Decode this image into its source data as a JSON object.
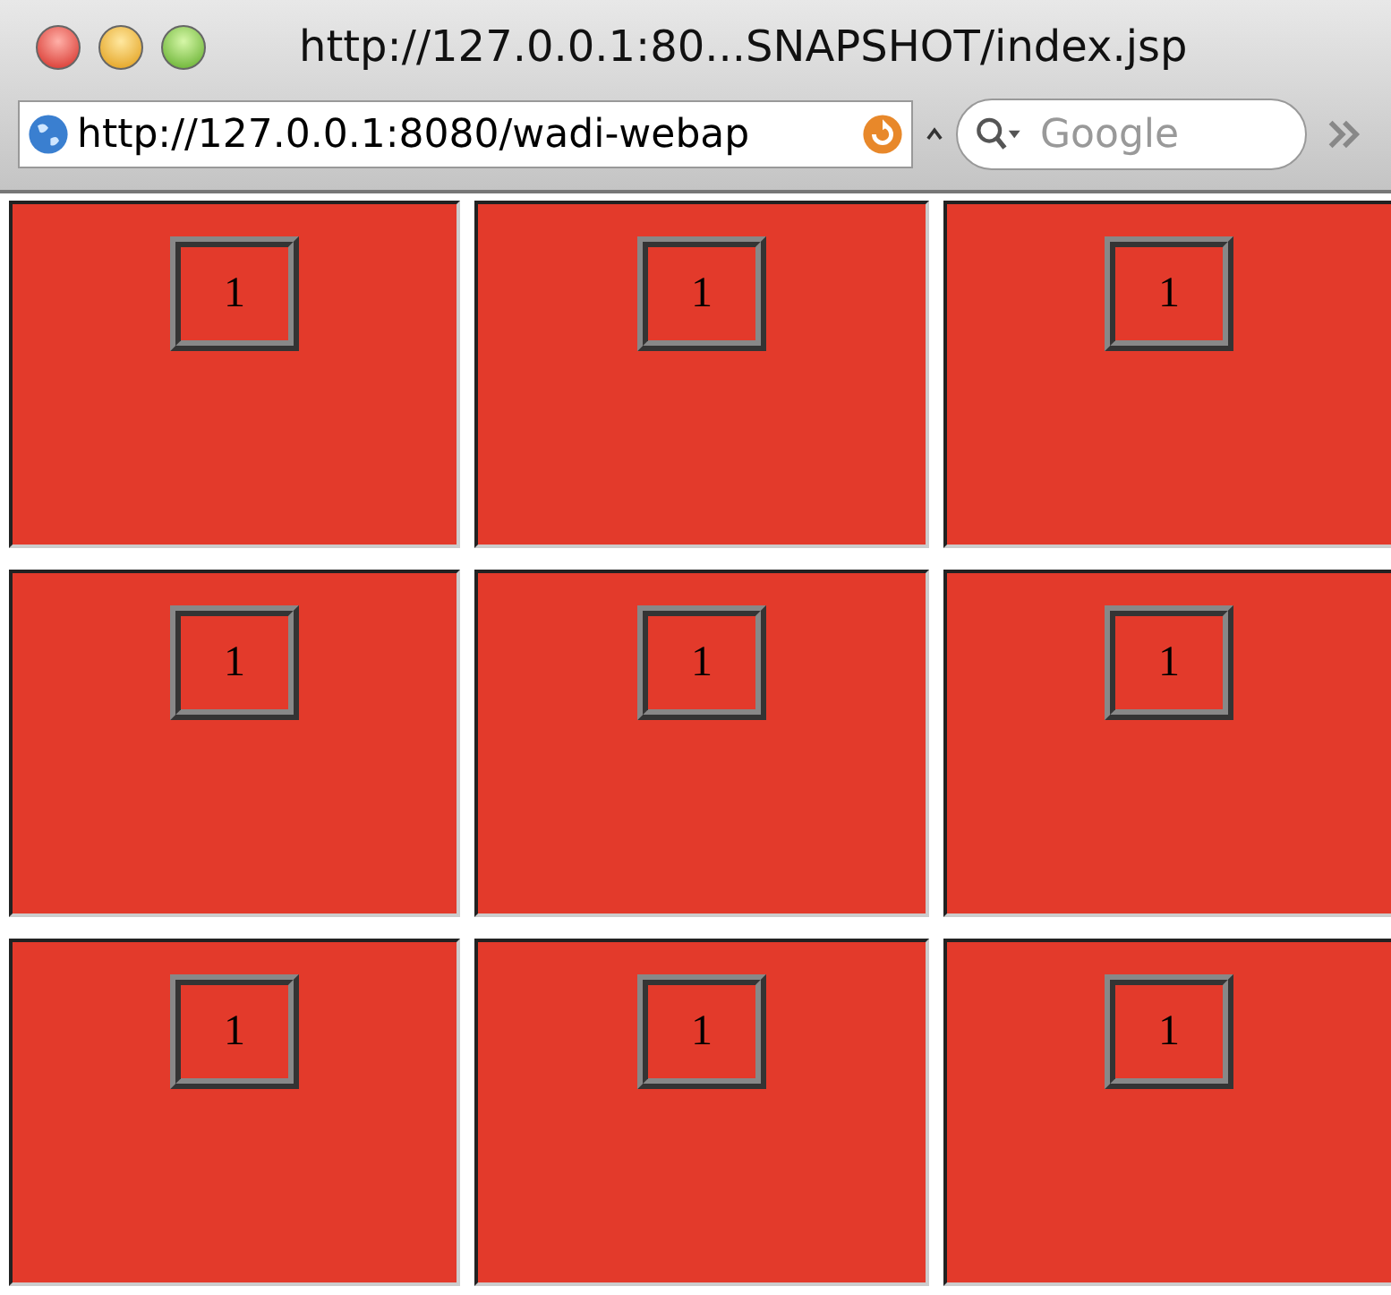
{
  "window": {
    "title": "http://127.0.0.1:80...SNAPSHOT/index.jsp"
  },
  "address_bar": {
    "value": "http://127.0.0.1:8080/wadi-webap"
  },
  "search": {
    "placeholder": "Google"
  },
  "grid": {
    "rows": [
      {
        "cells": [
          {
            "label": "1"
          },
          {
            "label": "1"
          },
          {
            "label": "1"
          }
        ]
      },
      {
        "cells": [
          {
            "label": "1"
          },
          {
            "label": "1"
          },
          {
            "label": "1"
          }
        ]
      },
      {
        "cells": [
          {
            "label": "1"
          },
          {
            "label": "1"
          },
          {
            "label": "1"
          }
        ]
      }
    ]
  }
}
